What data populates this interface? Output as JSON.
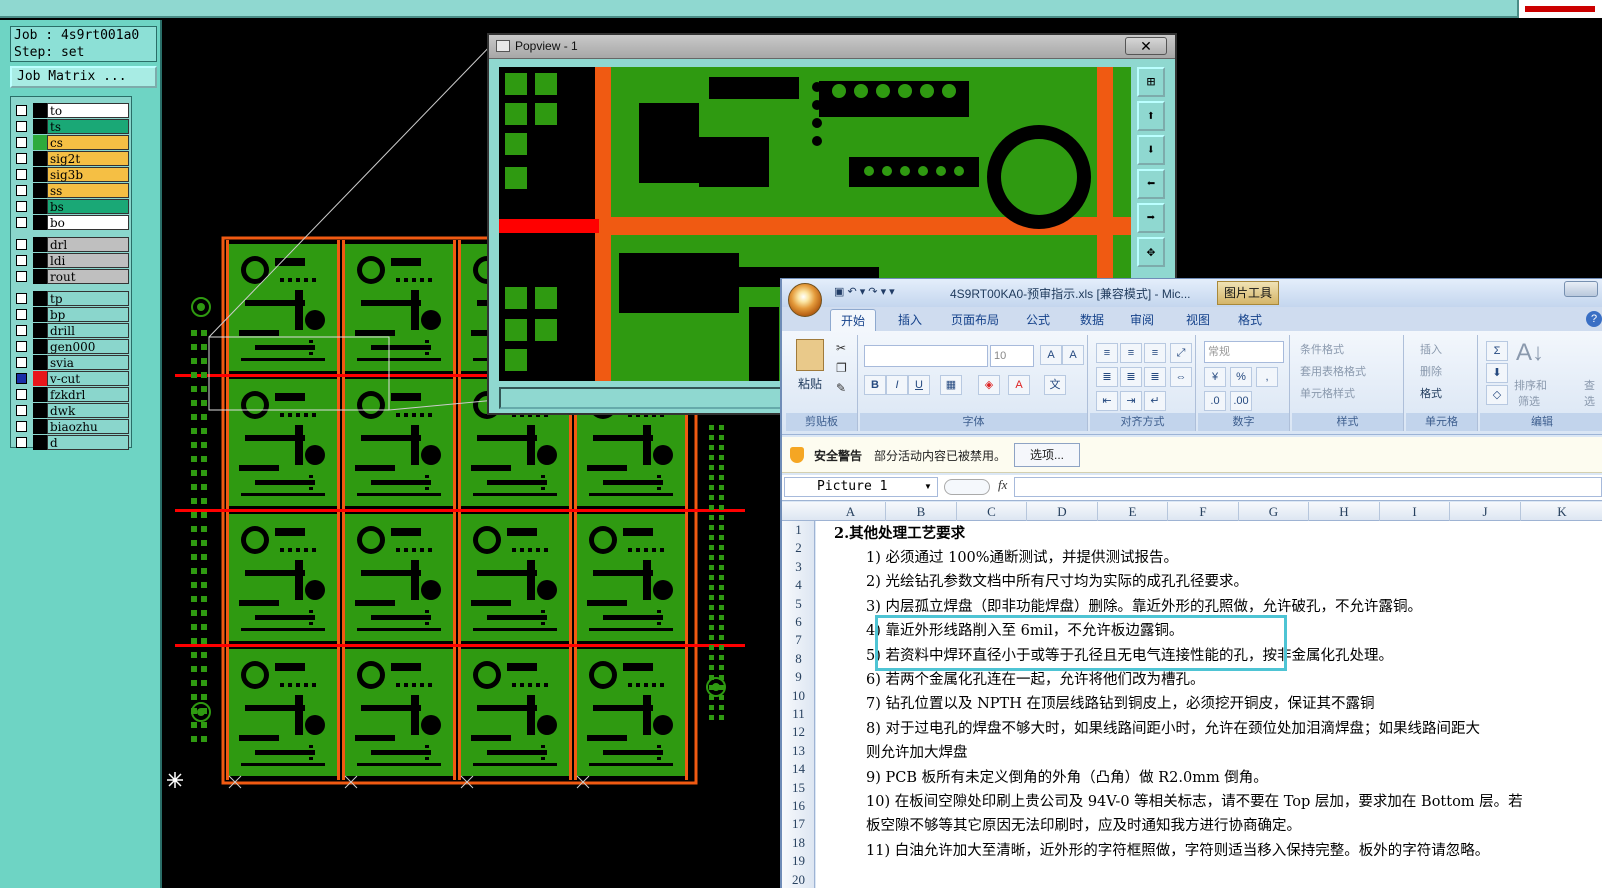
{
  "app": {
    "job": "Job : 4s9rt001a0",
    "step": "Step: set",
    "job_matrix_button": "Job Matrix ..."
  },
  "layers": [
    {
      "name": "to",
      "color": "#ffffff",
      "swatch": "#000000"
    },
    {
      "name": "ts",
      "color": "#1aa876",
      "swatch": "#000000"
    },
    {
      "name": "cs",
      "color": "#f5bf44",
      "swatch": "#2eaa3c"
    },
    {
      "name": "sig2t",
      "color": "#f5bf44",
      "swatch": "#000000"
    },
    {
      "name": "sig3b",
      "color": "#f5bf44",
      "swatch": "#000000"
    },
    {
      "name": "ss",
      "color": "#f5bf44",
      "swatch": "#000000"
    },
    {
      "name": "bs",
      "color": "#1aa876",
      "swatch": "#000000"
    },
    {
      "name": "bo",
      "color": "#ffffff",
      "swatch": "#000000"
    },
    {
      "name": "drl",
      "color": "#bfbfbf",
      "swatch": "#000000"
    },
    {
      "name": "ldi",
      "color": "#bfbfbf",
      "swatch": "#000000"
    },
    {
      "name": "rout",
      "color": "#bfbfbf",
      "swatch": "#000000"
    },
    {
      "name": "tp",
      "color": "#8ad6cc",
      "swatch": "#000000"
    },
    {
      "name": "bp",
      "color": "#8ad6cc",
      "swatch": "#000000"
    },
    {
      "name": "drill",
      "color": "#8ad6cc",
      "swatch": "#000000"
    },
    {
      "name": "gen000",
      "color": "#8ad6cc",
      "swatch": "#000000"
    },
    {
      "name": "svia",
      "color": "#8ad6cc",
      "swatch": "#000000"
    },
    {
      "name": "v-cut",
      "color": "#8ad6cc",
      "swatch": "#e8161a"
    },
    {
      "name": "fzkdrl",
      "color": "#8ad6cc",
      "swatch": "#000000"
    },
    {
      "name": "dwk",
      "color": "#8ad6cc",
      "swatch": "#000000"
    },
    {
      "name": "biaozhu",
      "color": "#8ad6cc",
      "swatch": "#000000"
    },
    {
      "name": "d",
      "color": "#8ad6cc",
      "swatch": "#000000"
    }
  ],
  "popview": {
    "title": "Popview - 1",
    "close": "✕"
  },
  "excel": {
    "qat": "▣ ↶ ▾ ↷ ▾ ▾",
    "window_title": "4S9RT00KA0-预审指示.xls  [兼容模式] - Mic...",
    "picture_tools": "图片工具",
    "tabs": [
      "开始",
      "插入",
      "页面布局",
      "公式",
      "数据",
      "审阅",
      "视图",
      "格式"
    ],
    "ribbon": {
      "paste": "粘贴",
      "clipboard": "剪贴板",
      "font_group": "字体",
      "font_size": "10",
      "align_group": "对齐方式",
      "number_format": "常规",
      "number_group": "数字",
      "cond_format": "条件格式",
      "table_format": "套用表格格式",
      "cell_style": "单元格样式",
      "style_group": "样式",
      "insert": "插入",
      "delete": "删除",
      "format": "格式",
      "cells_group": "单元格",
      "sort_filter": "排序和",
      "filter": "筛选",
      "find": "查",
      "select": "选",
      "edit_group": "编辑"
    },
    "security_warning": "安全警告",
    "security_text": "部分活动内容已被禁用。",
    "options_button": "选项...",
    "name_box": "Picture 1",
    "columns": [
      "A",
      "B",
      "C",
      "D",
      "E",
      "F",
      "G",
      "H",
      "I",
      "J",
      "K"
    ],
    "rows": [
      "1",
      "2",
      "3",
      "4",
      "5",
      "6",
      "7",
      "8",
      "9",
      "10",
      "11",
      "12",
      "13",
      "14",
      "15",
      "16",
      "17",
      "18",
      "19",
      "20"
    ],
    "content_title": "2.其他处理工艺要求",
    "lines": [
      "1)  必须通过 100%通断测试，并提供测试报告。",
      "2)  光绘钻孔参数文档中所有尺寸均为实际的成孔孔径要求。",
      "3)  内层孤立焊盘（即非功能焊盘）删除。靠近外形的孔照做，允许破孔，不允许露铜。",
      "4)  靠近外形线路削入至 6mil，不允许板边露铜。",
      "5)  若资料中焊环直径小于或等于孔径且无电气连接性能的孔，按非金属化孔处理。",
      "6)  若两个金属化孔连在一起，允许将他们改为槽孔。",
      "7)  钻孔位置以及 NPTH 在顶层线路钻到铜皮上，必须挖开铜皮，保证其不露铜",
      "8)  对于过电孔的焊盘不够大时，如果线路间距小时，允许在颈位处加泪滴焊盘；如果线路间距大",
      "    则允许加大焊盘",
      "9)  PCB 板所有未定义倒角的外角（凸角）做 R2.0mm 倒角。",
      "10) 在板间空隙处印刷上贵公司及 94V-0 等相关标志，请不要在 Top 层加，要求加在 Bottom 层。若",
      "    板空隙不够等其它原因无法印刷时，应及时通知我方进行协商确定。",
      "11) 白油允许加大至清晰，近外形的字符框照做，字符则适当移入保持完整。板外的字符请忽略。"
    ]
  },
  "colors": {
    "pcb_green": "#2f9a11",
    "pcb_orange": "#f05a12",
    "vcut_red": "#ff0000",
    "panel_teal": "#6ed4c4"
  }
}
